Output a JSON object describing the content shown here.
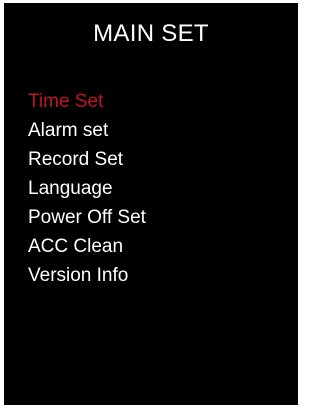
{
  "screen": {
    "title": "MAIN SET",
    "menu_items": [
      {
        "label": "Time Set",
        "selected": true
      },
      {
        "label": "Alarm set",
        "selected": false
      },
      {
        "label": "Record Set",
        "selected": false
      },
      {
        "label": "Language",
        "selected": false
      },
      {
        "label": "Power Off Set",
        "selected": false
      },
      {
        "label": "ACC Clean",
        "selected": false
      },
      {
        "label": "Version Info",
        "selected": false
      }
    ]
  },
  "colors": {
    "background": "#000000",
    "text": "#ffffff",
    "selected": "#c0161e"
  }
}
